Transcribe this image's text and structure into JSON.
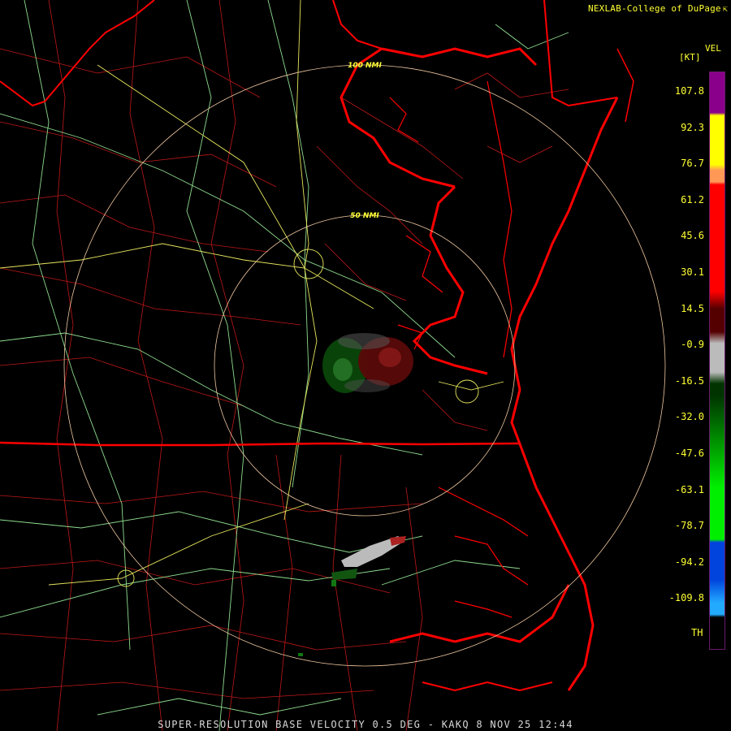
{
  "credit": "NEXLAB-College of DuPage",
  "legend": {
    "product": "VEL",
    "units": "[KT]",
    "ticks": [
      "107.8",
      "92.3",
      "76.7",
      "61.2",
      "45.6",
      "30.1",
      "14.5",
      "-0.9",
      "-16.5",
      "-32.0",
      "-47.6",
      "-63.1",
      "-78.7",
      "-94.2",
      "-109.8"
    ],
    "threshold_label": "TH",
    "colors": {
      "purple": "#8b008b",
      "yellow": "#ffff00",
      "orange": "#ff9955",
      "red": "#ff0000",
      "dark_red": "#550000",
      "gray": "#bbbbbb",
      "dark_green": "#003300",
      "green": "#00ee00",
      "blue": "#0044dd",
      "sky": "#22aaff"
    }
  },
  "range_rings": {
    "inner_label": "50 NMI",
    "outer_label": "100 NMI"
  },
  "caption": "SUPER-RESOLUTION BASE VELOCITY 0.5 DEG - KAKQ 8 NOV 25 12:44"
}
